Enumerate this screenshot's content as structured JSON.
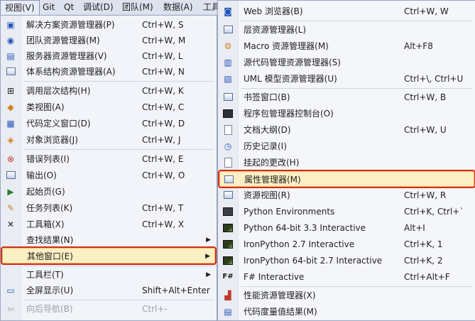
{
  "menubar": {
    "items": [
      {
        "label": "视图(V)"
      },
      {
        "label": "Git"
      },
      {
        "label": "Qt"
      },
      {
        "label": "调试(D)"
      },
      {
        "label": "团队(M)"
      },
      {
        "label": "数据(A)"
      },
      {
        "label": "工具"
      }
    ]
  },
  "view_menu": {
    "items": [
      {
        "label": "解决方案资源管理器(P)",
        "shortcut": "Ctrl+W, S",
        "icon": "solution-explorer-icon"
      },
      {
        "label": "团队资源管理器(M)",
        "shortcut": "Ctrl+W, M",
        "icon": "team-explorer-icon"
      },
      {
        "label": "服务器资源管理器(V)",
        "shortcut": "Ctrl+W, L",
        "icon": "server-explorer-icon"
      },
      {
        "label": "体系结构资源管理器(A)",
        "shortcut": "Ctrl+W, N",
        "icon": "architecture-explorer-icon"
      },
      {
        "label": "调用层次结构(H)",
        "shortcut": "Ctrl+W, K",
        "icon": "call-hierarchy-icon"
      },
      {
        "label": "类视图(A)",
        "shortcut": "Ctrl+W, C",
        "icon": "class-view-icon"
      },
      {
        "label": "代码定义窗口(D)",
        "shortcut": "Ctrl+W, D",
        "icon": "code-definition-icon"
      },
      {
        "label": "对象浏览器(J)",
        "shortcut": "Ctrl+W, J",
        "icon": "object-browser-icon"
      },
      {
        "label": "错误列表(I)",
        "shortcut": "Ctrl+W, E",
        "icon": "error-list-icon"
      },
      {
        "label": "输出(O)",
        "shortcut": "Ctrl+W, O",
        "icon": "output-icon"
      },
      {
        "label": "起始页(G)",
        "shortcut": "",
        "icon": "start-page-icon"
      },
      {
        "label": "任务列表(K)",
        "shortcut": "Ctrl+W, T",
        "icon": "task-list-icon"
      },
      {
        "label": "工具箱(X)",
        "shortcut": "Ctrl+W, X",
        "icon": "toolbox-icon"
      },
      {
        "label": "查找结果(N)",
        "shortcut": "",
        "icon": ""
      },
      {
        "label": "其他窗口(E)",
        "shortcut": "",
        "icon": ""
      },
      {
        "label": "工具栏(T)",
        "shortcut": "",
        "icon": ""
      },
      {
        "label": "全屏显示(U)",
        "shortcut": "Shift+Alt+Enter",
        "icon": "full-screen-icon"
      },
      {
        "label": "向后导航(B)",
        "shortcut": "Ctrl+-",
        "icon": "navigate-backward-icon"
      }
    ]
  },
  "other_windows_menu": {
    "items": [
      {
        "label": "Web 浏览器(B)",
        "shortcut": "Ctrl+W, W",
        "icon": "web-browser-icon"
      },
      {
        "label": "层资源管理器(L)",
        "shortcut": "",
        "icon": "layer-explorer-icon"
      },
      {
        "label": "Macro 资源管理器(M)",
        "shortcut": "Alt+F8",
        "icon": "macro-explorer-icon"
      },
      {
        "label": "源代码管理资源管理器(S)",
        "shortcut": "",
        "icon": "source-control-icon"
      },
      {
        "label": "UML 模型资源管理器(U)",
        "shortcut": "Ctrl+\\, Ctrl+U",
        "icon": "uml-explorer-icon"
      },
      {
        "label": "书签窗口(B)",
        "shortcut": "Ctrl+W, B",
        "icon": "bookmark-icon"
      },
      {
        "label": "程序包管理器控制台(O)",
        "shortcut": "",
        "icon": "package-console-icon"
      },
      {
        "label": "文档大纲(D)",
        "shortcut": "Ctrl+W, U",
        "icon": "document-outline-icon"
      },
      {
        "label": "历史记录(I)",
        "shortcut": "",
        "icon": "history-icon"
      },
      {
        "label": "挂起的更改(H)",
        "shortcut": "",
        "icon": "pending-changes-icon"
      },
      {
        "label": "属性管理器(M)",
        "shortcut": "",
        "icon": "property-manager-icon"
      },
      {
        "label": "资源视图(R)",
        "shortcut": "Ctrl+W, R",
        "icon": "resource-view-icon"
      },
      {
        "label": "Python Environments",
        "shortcut": "Ctrl+K, Ctrl+`",
        "icon": "python-environments-icon"
      },
      {
        "label": "Python 64-bit 3.3 Interactive",
        "shortcut": "Alt+I",
        "icon": "python-interactive-icon"
      },
      {
        "label": "IronPython 2.7 Interactive",
        "shortcut": "Ctrl+K, 1",
        "icon": "ironpython-interactive-icon"
      },
      {
        "label": "IronPython 64-bit 2.7 Interactive",
        "shortcut": "Ctrl+K, 2",
        "icon": "ironpython64-interactive-icon"
      },
      {
        "label": "F# Interactive",
        "shortcut": "Ctrl+Alt+F",
        "icon": "fsharp-interactive-icon"
      },
      {
        "label": "性能资源管理器(X)",
        "shortcut": "",
        "icon": "performance-explorer-icon"
      },
      {
        "label": "代码度量值结果(M)",
        "shortcut": "",
        "icon": "code-metrics-icon"
      }
    ]
  }
}
